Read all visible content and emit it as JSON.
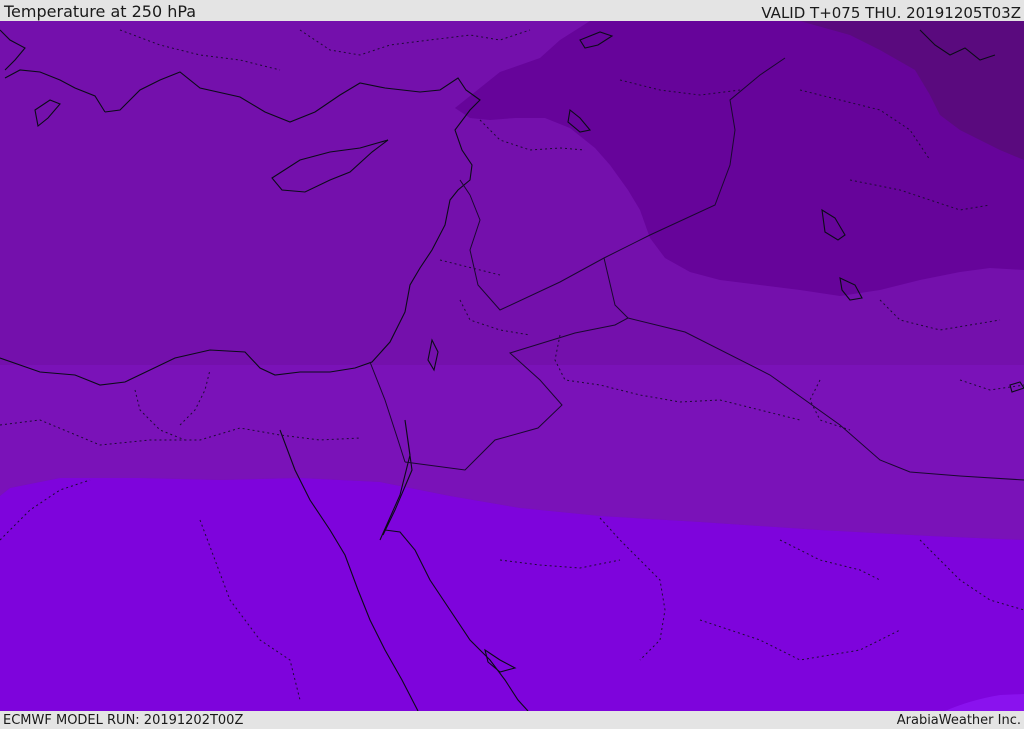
{
  "header": {
    "title": "Temperature at 250 hPa",
    "valid": "VALID T+075 THU. 20191205T03Z"
  },
  "footer": {
    "model_run": "ECMWF MODEL RUN: 20191202T00Z",
    "credit": "ArabiaWeather Inc."
  },
  "colors": {
    "band_coldest": "#5a0a7e",
    "band_cold": "#66049a",
    "band_mid": "#7410ac",
    "band_south": "#7a12b8",
    "band_warm": "#7e04dc",
    "band_warmest": "#8a12ee",
    "coast": "#0b0b18",
    "border": "#1a0830"
  }
}
